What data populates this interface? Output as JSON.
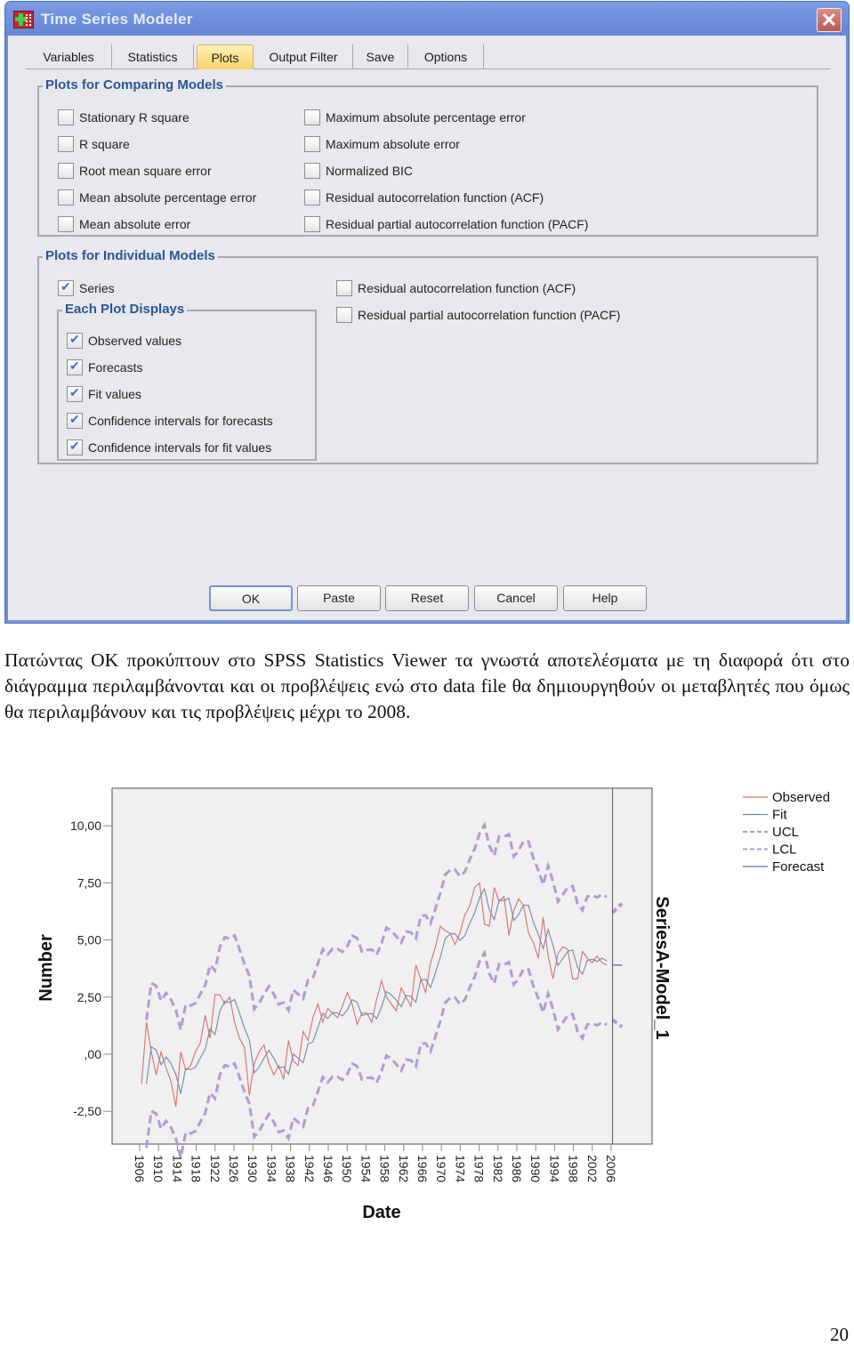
{
  "dialog": {
    "title": "Time Series Modeler",
    "close_label": "✕",
    "tabs": [
      {
        "label": "Variables",
        "active": false
      },
      {
        "label": "Statistics",
        "active": false
      },
      {
        "label": "Plots",
        "active": true
      },
      {
        "label": "Output Filter",
        "active": false
      },
      {
        "label": "Save",
        "active": false
      },
      {
        "label": "Options",
        "active": false
      }
    ],
    "comparing_models": {
      "title": "Plots for Comparing Models",
      "left": [
        {
          "label": "Stationary R square",
          "checked": false
        },
        {
          "label": "R square",
          "checked": false
        },
        {
          "label": "Root mean square error",
          "checked": false
        },
        {
          "label": "Mean absolute percentage error",
          "checked": false
        },
        {
          "label": "Mean absolute error",
          "checked": false
        }
      ],
      "right": [
        {
          "label": "Maximum absolute percentage error",
          "checked": false
        },
        {
          "label": "Maximum absolute error",
          "checked": false
        },
        {
          "label": "Normalized BIC",
          "checked": false
        },
        {
          "label": "Residual autocorrelation function (ACF)",
          "checked": false
        },
        {
          "label": "Residual partial autocorrelation function (PACF)",
          "checked": false
        }
      ]
    },
    "individual_models": {
      "title": "Plots for Individual Models",
      "series": {
        "label": "Series",
        "checked": true
      },
      "each_plot_title": "Each Plot Displays",
      "each_plot": [
        {
          "label": "Observed values",
          "checked": true
        },
        {
          "label": "Forecasts",
          "checked": true
        },
        {
          "label": "Fit values",
          "checked": true
        },
        {
          "label": "Confidence intervals for forecasts",
          "checked": true
        },
        {
          "label": "Confidence intervals for fit values",
          "checked": true
        }
      ],
      "right": [
        {
          "label": "Residual autocorrelation function (ACF)",
          "checked": false
        },
        {
          "label": "Residual partial autocorrelation function (PACF)",
          "checked": false
        }
      ]
    },
    "buttons": {
      "ok": "OK",
      "paste": "Paste",
      "reset": "Reset",
      "cancel": "Cancel",
      "help": "Help"
    }
  },
  "paragraph": "Πατώντας OK προκύπτουν στο SPSS Statistics Viewer τα γνωστά αποτελέσματα με τη διαφορά ότι στο διάγραμμα περιλαμβάνονται και οι προβλέψεις ενώ στο data file θα δημιουργηθούν οι μεταβλητές που όμως θα περιλαμβάνουν και τις προβλέψεις μέχρι το 2008.",
  "page_number": "20",
  "colors": {
    "observed": "#d9706b",
    "fit": "#6f89b0",
    "limits": "#b39ad4",
    "forecast": "#5a6f9a",
    "plot_bg": "#f0f0f0"
  },
  "chart_data": {
    "type": "line",
    "title": "",
    "xlabel": "Date",
    "ylabel": "Number",
    "panel_label": "SeriesA-Model_1",
    "ylim": [
      -3.1,
      12.4
    ],
    "xlim": [
      1902,
      2011
    ],
    "separator_year": 2006.3,
    "yticks": [
      10,
      7.5,
      5,
      2.5,
      0,
      -2.5
    ],
    "ytick_labels": [
      "10,00",
      "7,50",
      "5,00",
      "2,50",
      ",00",
      "-2,50"
    ],
    "xtick_labels": [
      "1906",
      "1910",
      "1914",
      "1918",
      "1922",
      "1926",
      "1930",
      "1934",
      "1938",
      "1942",
      "1946",
      "1950",
      "1954",
      "1958",
      "1962",
      "1966",
      "1970",
      "1974",
      "1978",
      "1982",
      "1986",
      "1990",
      "1994",
      "1998",
      "2002",
      "2006"
    ],
    "legend": [
      "Observed",
      "Fit",
      "UCL",
      "LCL",
      "Forecast"
    ],
    "legend_position": "top-right",
    "grid": false,
    "history_start": 1906.4,
    "history_end": 2005.1,
    "observed": [
      -1.3,
      1.4,
      0.1,
      -0.9,
      0.1,
      -0.6,
      -1.2,
      -2.3,
      0.1,
      -0.7,
      -0.5,
      0.1,
      0.5,
      1.7,
      0.7,
      2.6,
      2.6,
      2.2,
      2.5,
      1.4,
      0.7,
      0.3,
      -1.8,
      -0.4,
      0.1,
      0.4,
      -0.4,
      -0.9,
      -0.5,
      -1.1,
      0.6,
      -0.3,
      -0.5,
      1.0,
      0.6,
      1.6,
      2.2,
      1.4,
      2.0,
      1.8,
      1.6,
      2.1,
      2.7,
      2.2,
      1.3,
      1.8,
      1.8,
      1.4,
      2.4,
      3.2,
      2.5,
      2.2,
      1.9,
      2.9,
      2.5,
      2.1,
      3.9,
      3.3,
      2.7,
      4.0,
      4.7,
      5.6,
      5.4,
      5.3,
      4.8,
      5.3,
      6.1,
      6.5,
      7.3,
      7.5,
      5.7,
      5.6,
      7.3,
      6.7,
      6.9,
      5.2,
      6.3,
      6.8,
      6.5,
      5.3,
      4.9,
      4.2,
      6.0,
      4.3,
      3.3,
      4.4,
      4.7,
      4.6,
      3.3,
      3.3,
      4.5,
      4.2,
      4.0,
      4.3,
      4.0,
      3.9
    ],
    "fit": [
      null,
      -1.3,
      0.32,
      0.19,
      -0.46,
      -0.12,
      -0.41,
      -0.88,
      -1.73,
      -0.63,
      -0.67,
      -0.57,
      -0.17,
      0.23,
      1.11,
      0.86,
      1.9,
      2.32,
      2.25,
      2.4,
      1.8,
      1.14,
      0.64,
      -0.82,
      -0.57,
      -0.17,
      0.17,
      -0.17,
      -0.61,
      -0.54,
      -0.88,
      0.01,
      -0.18,
      -0.37,
      0.45,
      0.54,
      1.18,
      1.79,
      1.56,
      1.82,
      1.81,
      1.68,
      1.93,
      2.39,
      2.28,
      1.69,
      1.76,
      1.78,
      1.55,
      2.06,
      2.74,
      2.6,
      2.36,
      2.08,
      2.57,
      2.53,
      2.27,
      3.25,
      3.28,
      2.93,
      3.57,
      4.25,
      5.06,
      5.26,
      5.28,
      4.99,
      5.18,
      5.73,
      6.19,
      6.86,
      7.24,
      6.32,
      5.89,
      6.74,
      6.72,
      6.83,
      5.85,
      6.12,
      6.53,
      6.51,
      5.78,
      5.25,
      4.62,
      5.45,
      4.76,
      3.88,
      4.19,
      4.5,
      4.56,
      3.8,
      3.5,
      4.1,
      4.16,
      4.06,
      4.2,
      4.08
    ],
    "band_half_width": 2.8,
    "forecast": {
      "years": [
        2006.3,
        2008.3
      ],
      "values": [
        3.9,
        3.9
      ],
      "ucl": [
        6.2,
        6.6
      ],
      "lcl": [
        1.5,
        1.2
      ]
    }
  }
}
